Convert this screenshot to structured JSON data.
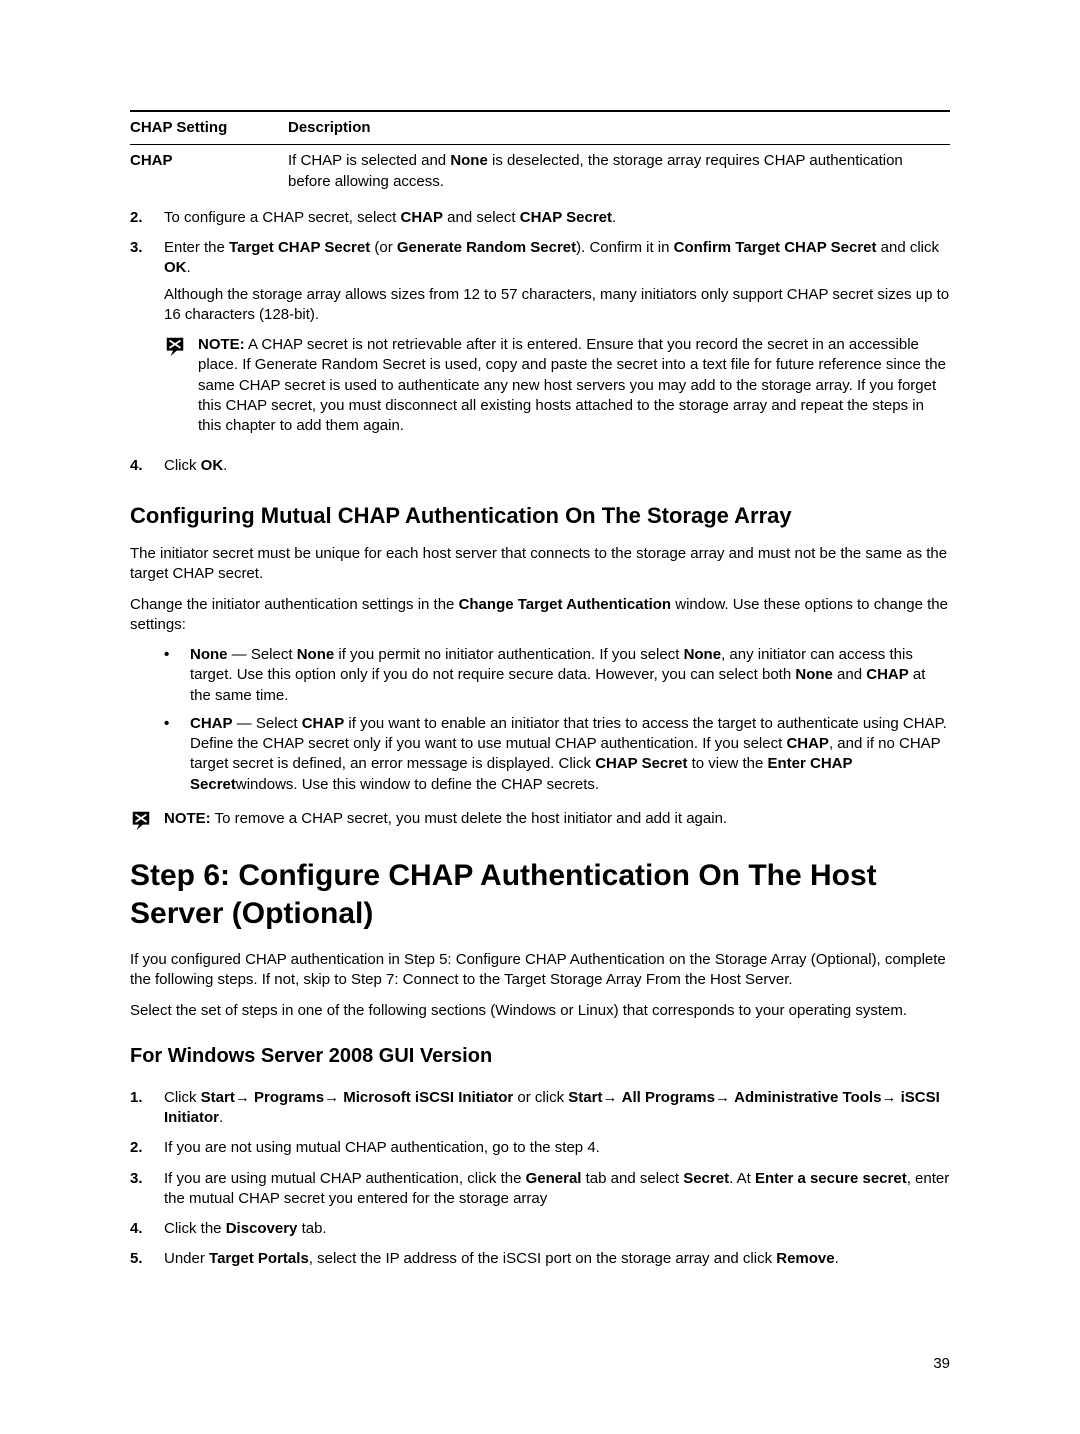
{
  "table": {
    "head_setting": "CHAP Setting",
    "head_desc": "Description",
    "row1_setting": "CHAP",
    "row1_desc_1": "If CHAP is selected and ",
    "row1_desc_b": "None",
    "row1_desc_2": " is deselected, the storage array requires CHAP authentication before allowing access."
  },
  "steps_a": {
    "n2": "2.",
    "s2_1": "To configure a CHAP secret, select ",
    "s2_b1": "CHAP",
    "s2_2": " and select ",
    "s2_b2": "CHAP Secret",
    "s2_3": ".",
    "n3": "3.",
    "s3_1": "Enter the ",
    "s3_b1": "Target CHAP Secret",
    "s3_2": " (or ",
    "s3_b2": "Generate Random Secret",
    "s3_3": "). Confirm it in ",
    "s3_b3": "Confirm Target CHAP Secret",
    "s3_4": " and click ",
    "s3_b4": "OK",
    "s3_5": ".",
    "s3_para": "Although the storage array allows sizes from 12 to 57 characters, many initiators only support CHAP secret sizes up to 16 characters (128-bit).",
    "note_label": "NOTE:",
    "note_txt": " A CHAP secret is not retrievable after it is entered. Ensure that you record the secret in an accessible place. If Generate Random Secret is used, copy and paste the secret into a text file for future reference since the same CHAP secret is used to authenticate any new host servers you may add to the storage array. If you forget this CHAP secret, you must disconnect all existing hosts attached to the storage array and repeat the steps in this chapter to add them again.",
    "n4": "4.",
    "s4_1": "Click ",
    "s4_b1": "OK",
    "s4_2": "."
  },
  "sec1": {
    "title": "Configuring Mutual CHAP Authentication On The Storage Array",
    "p1": "The initiator secret must be unique for each host server that connects to the storage array and must not be the same as the target CHAP secret.",
    "p2_1": "Change the initiator authentication settings in the ",
    "p2_b": "Change Target Authentication",
    "p2_2": " window. Use these options to change the settings:",
    "bul1_b1": "None",
    "bul1_t1": " — Select ",
    "bul1_b2": "None",
    "bul1_t2": " if you permit no initiator authentication. If you select ",
    "bul1_b3": "None",
    "bul1_t3": ", any initiator can access this target. Use this option only if you do not require secure data. However, you can select both ",
    "bul1_b4": "None",
    "bul1_t4": " and ",
    "bul1_b5": "CHAP",
    "bul1_t5": " at the same time.",
    "bul2_b1": "CHAP",
    "bul2_t1": " — Select ",
    "bul2_b2": "CHAP",
    "bul2_t2": " if you want to enable an initiator that tries to access the target to authenticate using CHAP. Define the CHAP secret only if you want to use mutual CHAP authentication. If you select ",
    "bul2_b3": "CHAP",
    "bul2_t3": ", and if no CHAP target secret is defined, an error message is displayed. Click ",
    "bul2_b4": "CHAP Secret",
    "bul2_t4": " to view the ",
    "bul2_b5": "Enter CHAP Secret",
    "bul2_t5": "windows. Use this window to define the CHAP secrets.",
    "note_label": "NOTE:",
    "note_txt": " To remove a CHAP secret, you must delete the host initiator and add it again."
  },
  "big": {
    "title": "Step 6: Configure CHAP Authentication On The Host Server (Optional)",
    "p1": "If you configured CHAP authentication in Step 5: Configure CHAP Authentication on the Storage Array (Optional), complete the following steps. If not, skip to Step 7: Connect to the Target Storage Array From the Host Server.",
    "p2": "Select the set of steps in one of the following sections (Windows or Linux) that corresponds to your operating system."
  },
  "sub": {
    "title": "For Windows Server 2008 GUI Version"
  },
  "steps_b": {
    "n1": "1.",
    "s1_1": "Click ",
    "s1_b1": "Start",
    "s1_arrow": "→ ",
    "s1_b2": "Programs",
    "s1_b3": "Microsoft iSCSI Initiator",
    "s1_2": " or click ",
    "s1_b4": "Start",
    "s1_b5": "All Programs",
    "s1_b6": "Administrative Tools",
    "s1_b7": "iSCSI Initiator",
    "s1_3": ".",
    "n2": "2.",
    "s2": "If you are not using mutual CHAP authentication, go to the step 4.",
    "n3": "3.",
    "s3_1": "If you are using mutual CHAP authentication, click the ",
    "s3_b1": "General",
    "s3_2": " tab and select ",
    "s3_b2": "Secret",
    "s3_3": ". At ",
    "s3_b3": "Enter a secure secret",
    "s3_4": ", enter the mutual CHAP secret you entered for the storage array",
    "n4": "4.",
    "s4_1": "Click the ",
    "s4_b1": "Discovery",
    "s4_2": " tab.",
    "n5": "5.",
    "s5_1": "Under ",
    "s5_b1": "Target Portals",
    "s5_2": ", select the IP address of the iSCSI port on the storage array and click ",
    "s5_b2": "Remove",
    "s5_3": "."
  },
  "pagenum": "39"
}
